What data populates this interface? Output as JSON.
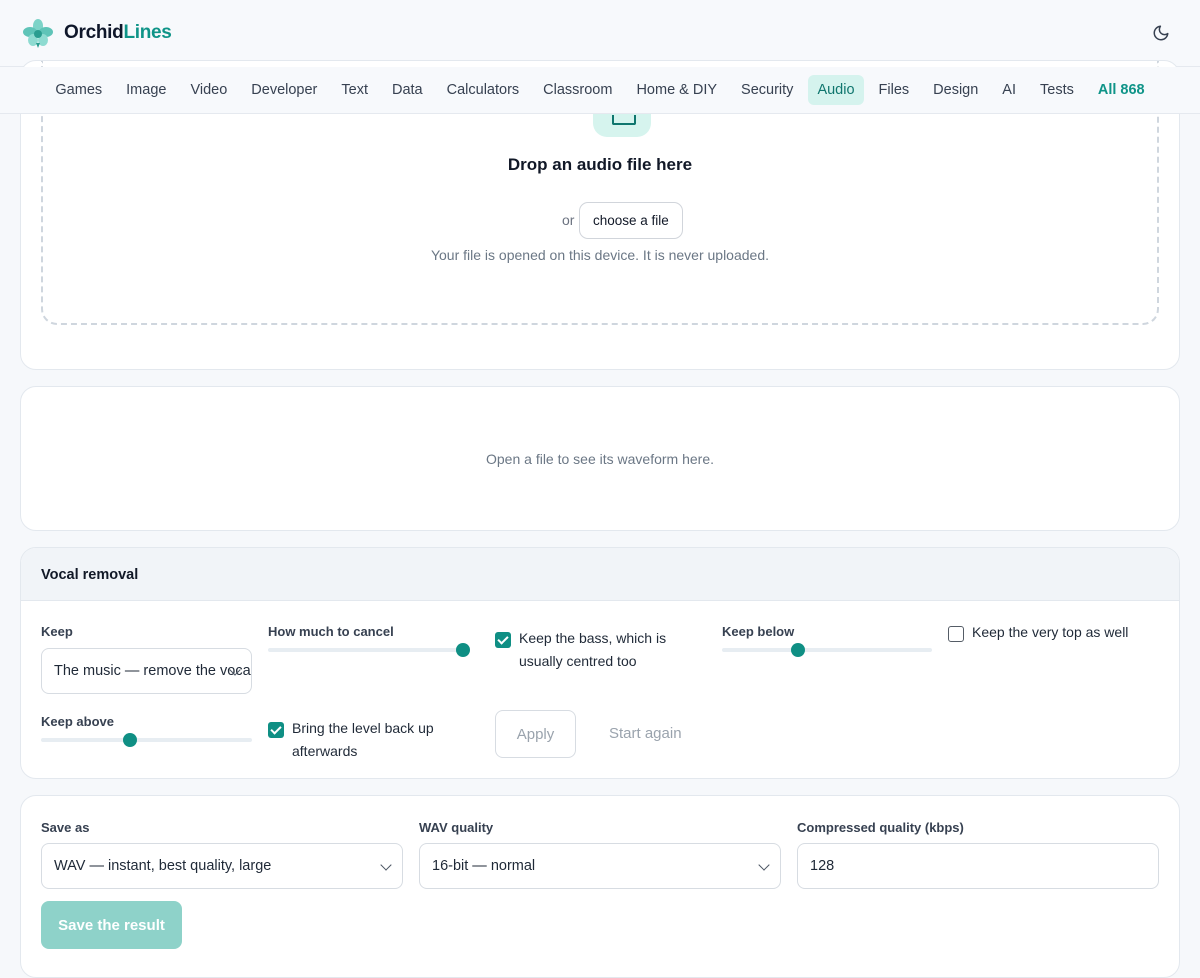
{
  "brand": {
    "name_part1": "Orchid",
    "name_part2": "Lines"
  },
  "header": {
    "theme_toggle_icon": "moon-icon"
  },
  "nav": {
    "items": [
      "Games",
      "Image",
      "Video",
      "Developer",
      "Text",
      "Data",
      "Calculators",
      "Classroom",
      "Home & DIY",
      "Security",
      "Audio",
      "Files",
      "Design",
      "AI",
      "Tests"
    ],
    "active": "Audio",
    "all_label": "All 868"
  },
  "dropzone": {
    "title": "Drop an audio file here",
    "or_text": "or",
    "choose_label": "choose a file",
    "note": "Your file is opened on this device. It is never uploaded."
  },
  "waveform": {
    "empty_text": "Open a file to see its waveform here."
  },
  "vocal": {
    "title": "Vocal removal",
    "keep_label": "Keep",
    "keep_value": "The music — remove the vocals",
    "cancel_label": "How much to cancel",
    "cancel_level": 1.0,
    "keep_bass_label": "Keep the bass, which is usually centred too",
    "keep_bass_checked": true,
    "keep_below_label": "Keep below",
    "keep_below_level": 0.36,
    "keep_top_label": "Keep the very top as well",
    "keep_top_checked": false,
    "keep_above_label": "Keep above",
    "keep_above_level": 0.42,
    "level_back_label": "Bring the level back up afterwards",
    "level_back_checked": true,
    "apply_label": "Apply",
    "reset_label": "Start again"
  },
  "save": {
    "format_label": "Save as",
    "format_value": "WAV — instant, best quality, large",
    "wav_label": "WAV quality",
    "wav_value": "16-bit — normal",
    "bitrate_label": "Compressed quality (kbps)",
    "bitrate_value": "128",
    "save_label": "Save the result"
  },
  "colors": {
    "accent": "#0f8f84",
    "accent_light": "#d5f3ee",
    "disabled_button": "#8ed2c9"
  }
}
